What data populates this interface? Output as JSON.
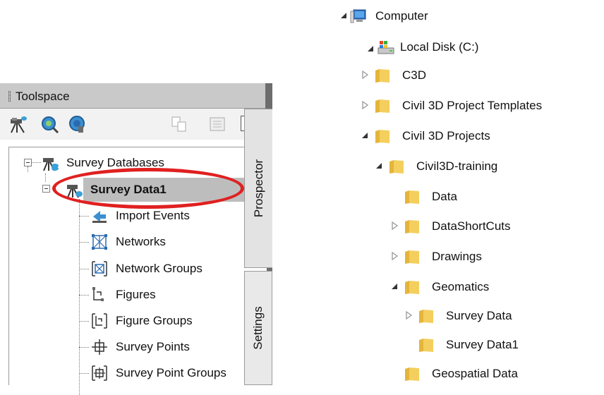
{
  "toolspace": {
    "title": "Toolspace",
    "toolbar_help": "?",
    "tabs": {
      "prospector": "Prospector",
      "settings": "Settings"
    },
    "tree": {
      "root": "Survey Databases",
      "selected": "Survey Data1",
      "children": [
        "Import Events",
        "Networks",
        "Network Groups",
        "Figures",
        "Figure Groups",
        "Survey Points",
        "Survey Point Groups"
      ]
    },
    "highlight_color": "#e02020"
  },
  "explorer": {
    "items": [
      {
        "label": "Computer",
        "icon": "computer-icon"
      },
      {
        "label": "Local Disk (C:)",
        "icon": "local-disk-icon"
      },
      {
        "label": "C3D",
        "icon": "folder-icon"
      },
      {
        "label": "Civil 3D Project Templates",
        "icon": "folder-icon"
      },
      {
        "label": "Civil 3D Projects",
        "icon": "folder-icon"
      },
      {
        "label": "Civil3D-training",
        "icon": "folder-icon"
      },
      {
        "label": "Data",
        "icon": "folder-icon"
      },
      {
        "label": "DataShortCuts",
        "icon": "folder-icon"
      },
      {
        "label": "Drawings",
        "icon": "folder-icon"
      },
      {
        "label": "Geomatics",
        "icon": "folder-icon"
      },
      {
        "label": "Survey Data",
        "icon": "folder-icon"
      },
      {
        "label": "Survey Data1",
        "icon": "folder-icon"
      },
      {
        "label": "Geospatial Data",
        "icon": "folder-icon"
      }
    ]
  }
}
